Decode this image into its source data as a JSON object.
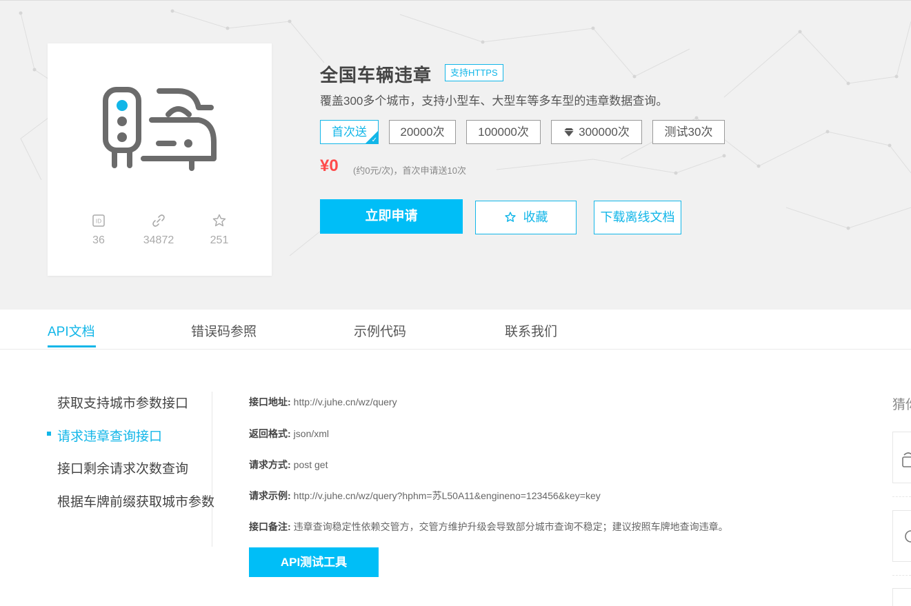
{
  "product": {
    "title": "全国车辆违章",
    "https_badge": "支持HTTPS",
    "subtitle": "覆盖300多个城市，支持小型车、大型车等多车型的违章数据查询。",
    "logo_icon": "traffic-light-car-icon",
    "stats": {
      "id_value": "36",
      "link_value": "34872",
      "star_value": "251"
    }
  },
  "packages": [
    {
      "label": "首次送",
      "selected": true
    },
    {
      "label": "20000次",
      "selected": false
    },
    {
      "label": "100000次",
      "selected": false
    },
    {
      "label": "300000次",
      "selected": false,
      "icon": "diamond-icon"
    },
    {
      "label": "测试30次",
      "selected": false
    }
  ],
  "price": {
    "amount": "¥0",
    "note": "(约0元/次)，首次申请送10次"
  },
  "actions": {
    "apply": "立即申请",
    "favorite": "收藏",
    "download": "下载离线文档"
  },
  "tabs": [
    "API文档",
    "错误码参照",
    "示例代码",
    "联系我们"
  ],
  "active_tab": "API文档",
  "sidenav": [
    {
      "label": "获取支持城市参数接口",
      "active": false
    },
    {
      "label": "请求违章查询接口",
      "active": true
    },
    {
      "label": "接口剩余请求次数查询",
      "active": false
    },
    {
      "label": "根据车牌前缀获取城市参数",
      "active": false
    }
  ],
  "details": [
    {
      "label": "接口地址:",
      "value": "http://v.juhe.cn/wz/query"
    },
    {
      "label": "返回格式:",
      "value": "json/xml"
    },
    {
      "label": "请求方式:",
      "value": "post get"
    },
    {
      "label": "请求示例:",
      "value": "http://v.juhe.cn/wz/query?hphm=苏L50A11&engineno=123456&key=key"
    },
    {
      "label": "接口备注:",
      "value": "违章查询稳定性依赖交管方，交管方维护升级会导致部分城市查询不稳定；建议按照车牌地查询违章。"
    }
  ],
  "test_tool": "API测试工具",
  "guess_title": "猜你",
  "colors": {
    "accent": "#12b6e8",
    "button": "#00bef7",
    "price": "#ff4a4a",
    "hero_bg": "#f1f1f1"
  }
}
